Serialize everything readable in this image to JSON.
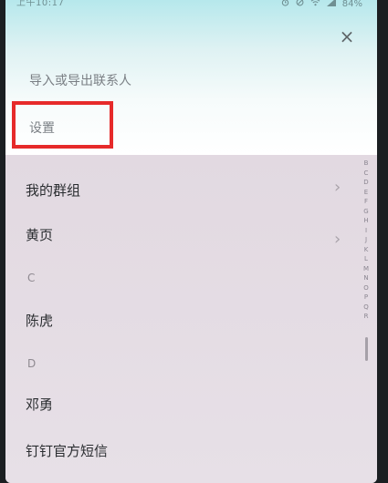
{
  "status_bar": {
    "time": "上午10:17",
    "icons": [
      "alarm-icon",
      "silent-icon",
      "wifi-icon",
      "signal-icon"
    ],
    "battery": "84%"
  },
  "menu": {
    "close_glyph": "×",
    "items": [
      {
        "label": "导入或导出联系人"
      },
      {
        "label": "设置"
      }
    ],
    "highlight_color": "#e62a2a"
  },
  "contacts": {
    "groups_label": "我的群组",
    "yellow_pages_label": "黄页",
    "sections": [
      {
        "letter": "C",
        "items": [
          "陈虎"
        ]
      },
      {
        "letter": "D",
        "items": [
          "邓勇",
          "钉钉官方短信"
        ]
      }
    ],
    "chevron_glyph": "›"
  },
  "alpha_index": [
    "B",
    "C",
    "D",
    "E",
    "F",
    "G",
    "H",
    "I",
    "J",
    "K",
    "L",
    "M",
    "N",
    "O",
    "P",
    "Q",
    "R"
  ]
}
